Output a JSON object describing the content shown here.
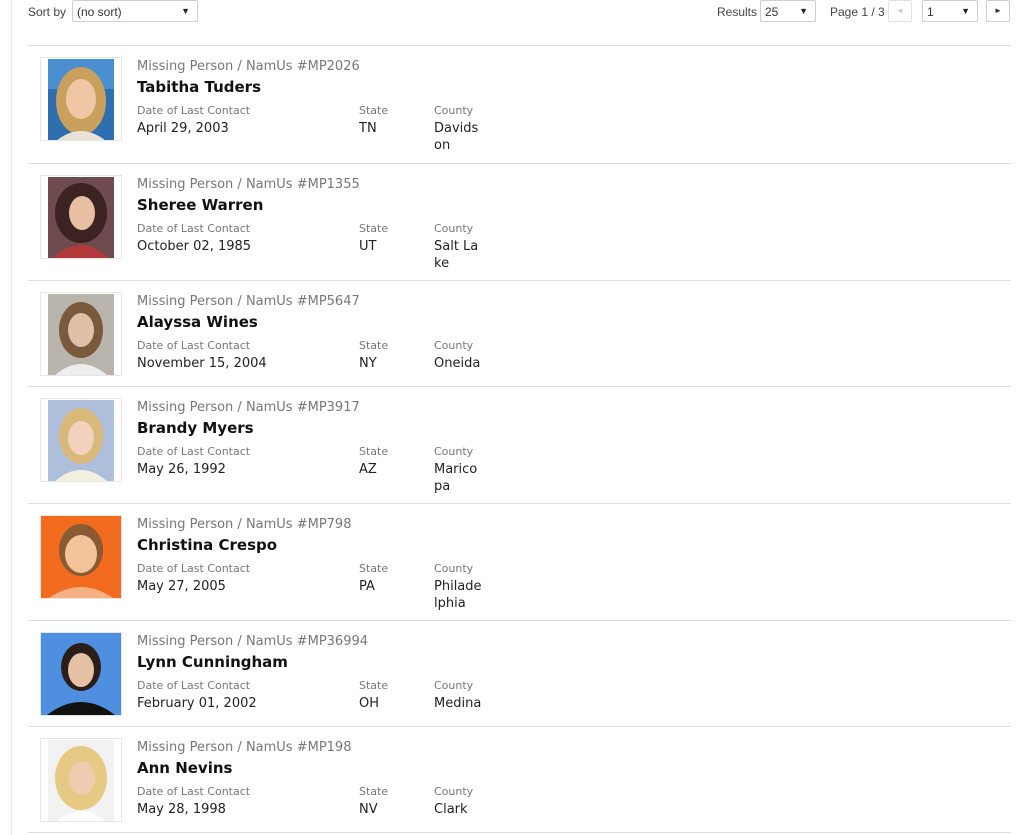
{
  "toolbar": {
    "sort_label": "Sort by",
    "sort_value": "(no sort)",
    "results_label": "Results",
    "results_value": "25",
    "page_label": "Page 1 / 3",
    "page_value": "1",
    "dropdown_arrow": "▼",
    "prev_icon": "◄",
    "next_icon": "►"
  },
  "labels": {
    "date": "Date of Last Contact",
    "state": "State",
    "county": "County"
  },
  "results": [
    {
      "case": "Missing Person / NamUs #MP2026",
      "name": "Tabitha Tuders",
      "date": "April 29, 2003",
      "state": "TN",
      "county": "Davidson"
    },
    {
      "case": "Missing Person / NamUs #MP1355",
      "name": "Sheree Warren",
      "date": "October 02, 1985",
      "state": "UT",
      "county": "Salt Lake"
    },
    {
      "case": "Missing Person / NamUs #MP5647",
      "name": "Alayssa Wines",
      "date": "November 15, 2004",
      "state": "NY",
      "county": "Oneida"
    },
    {
      "case": "Missing Person / NamUs #MP3917",
      "name": "Brandy Myers",
      "date": "May 26, 1992",
      "state": "AZ",
      "county": "Maricopa"
    },
    {
      "case": "Missing Person / NamUs #MP798",
      "name": "Christina Crespo",
      "date": "May 27, 2005",
      "state": "PA",
      "county": "Philadelphia"
    },
    {
      "case": "Missing Person / NamUs #MP36994",
      "name": "Lynn Cunningham",
      "date": "February 01, 2002",
      "state": "OH",
      "county": "Medina"
    },
    {
      "case": "Missing Person / NamUs #MP198",
      "name": "Ann Nevins",
      "date": "May 28, 1998",
      "state": "NV",
      "county": "Clark"
    }
  ],
  "colors": {
    "border": "#dedede",
    "id_text": "#777777",
    "name_text": "#111111"
  }
}
